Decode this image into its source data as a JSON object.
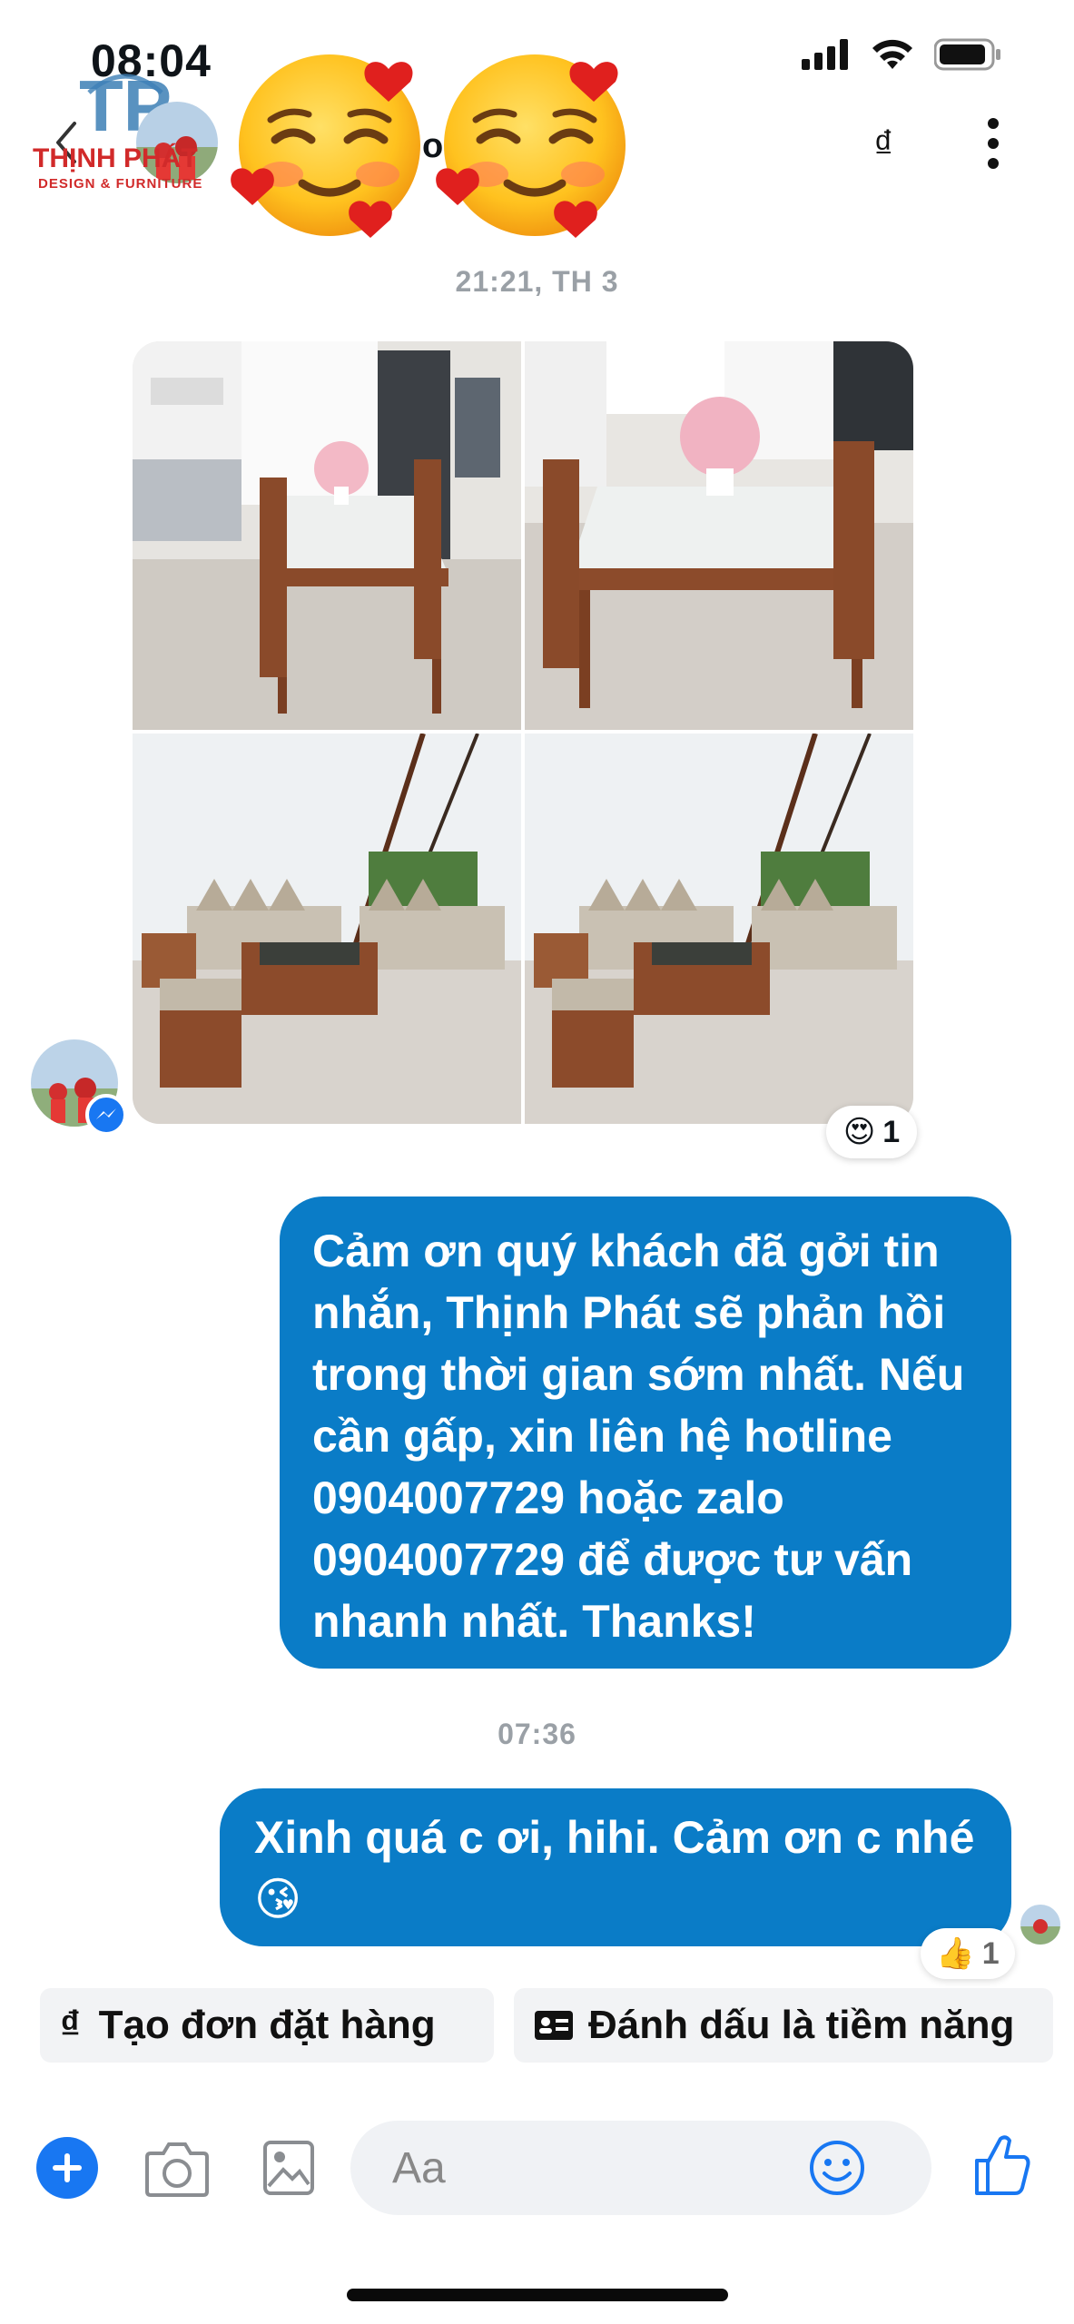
{
  "status_bar": {
    "time": "08:04"
  },
  "header": {
    "brand_name": "THỊNH PHÁT",
    "brand_sub": "DESIGN & FURNITURE",
    "brand_mark": "TP",
    "contact_initial": "o",
    "currency_icon": "₫"
  },
  "conversation": {
    "timestamp_1": "21:21, TH 3",
    "photo_reaction": {
      "emoji": "😍",
      "count": "1"
    },
    "auto_reply": "Cảm ơn quý khách đã gởi tin nhắn, Thịnh Phát sẽ phản hồi trong thời gian sớm nhất. Nếu cần gấp, xin liên hệ hotline 0904007729 hoặc zalo 0904007729 để được tư vấn nhanh nhất. Thanks!",
    "timestamp_2": "07:36",
    "reply_text": "Xinh quá c ơi, hihi. Cảm ơn c nhé",
    "reply_emoji": "😘",
    "reply_reaction": {
      "emoji": "👍",
      "count": "1"
    }
  },
  "quick_actions": {
    "create_order_icon": "₫",
    "create_order": "Tạo đơn đặt hàng",
    "mark_potential": "Đánh dấu là tiềm năng"
  },
  "composer": {
    "placeholder": "Aa"
  },
  "colors": {
    "bubble": "#0a7cc7",
    "accent": "#1877f2"
  },
  "icons": [
    "back-chevron-icon",
    "signal-icon",
    "wifi-icon",
    "battery-icon",
    "more-icon",
    "plus-icon",
    "camera-icon",
    "gallery-icon",
    "emoji-icon",
    "like-icon"
  ]
}
